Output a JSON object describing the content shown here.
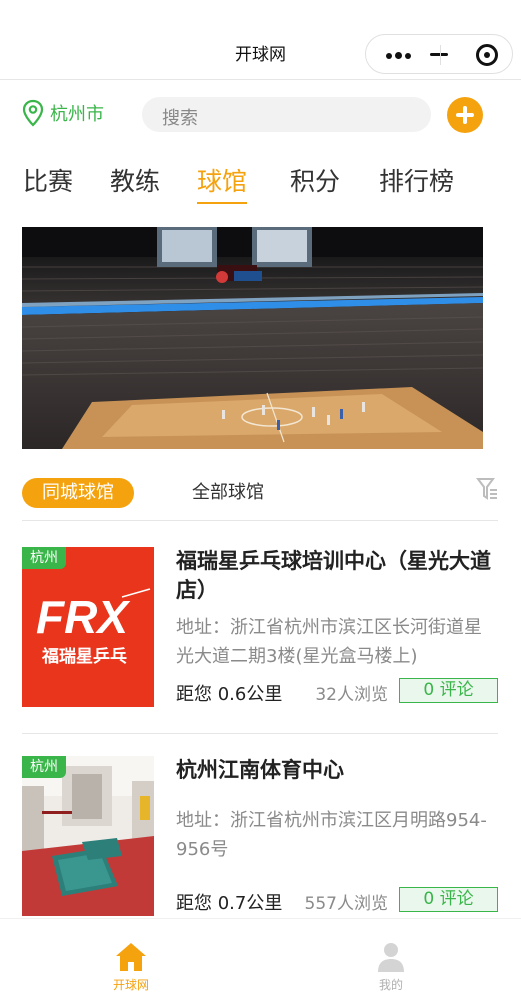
{
  "app": {
    "title": "开球网"
  },
  "header": {
    "location": "杭州市",
    "search_placeholder": "搜索"
  },
  "tabs": [
    {
      "label": "比赛",
      "active": false
    },
    {
      "label": "教练",
      "active": false
    },
    {
      "label": "球馆",
      "active": true
    },
    {
      "label": "积分",
      "active": false
    },
    {
      "label": "排行榜",
      "active": false
    }
  ],
  "filters": {
    "local": "同城球馆",
    "all": "全部球馆"
  },
  "venues": [
    {
      "city": "杭州",
      "logo_text": "FRX",
      "logo_subtext": "福瑞星乒乓",
      "name": "福瑞星乒乓球培训中心（星光大道店）",
      "address": "地址：浙江省杭州市滨江区长河街道星光大道二期3楼(星光盒马楼上)",
      "distance": "距您 0.6公里",
      "views": "32人浏览",
      "comments": "0 评论"
    },
    {
      "city": "杭州",
      "name": "杭州江南体育中心",
      "address": "地址：浙江省杭州市滨江区月明路954-956号",
      "distance": "距您 0.7公里",
      "views": "557人浏览",
      "comments": "0 评论"
    }
  ],
  "tabbar": [
    {
      "label": "开球网",
      "active": true,
      "icon": "home-icon"
    },
    {
      "label": "我的",
      "active": false,
      "icon": "user-icon"
    }
  ],
  "colors": {
    "accent": "#f5a20f",
    "green": "#3ab54a",
    "logo_red": "#e8351c"
  }
}
